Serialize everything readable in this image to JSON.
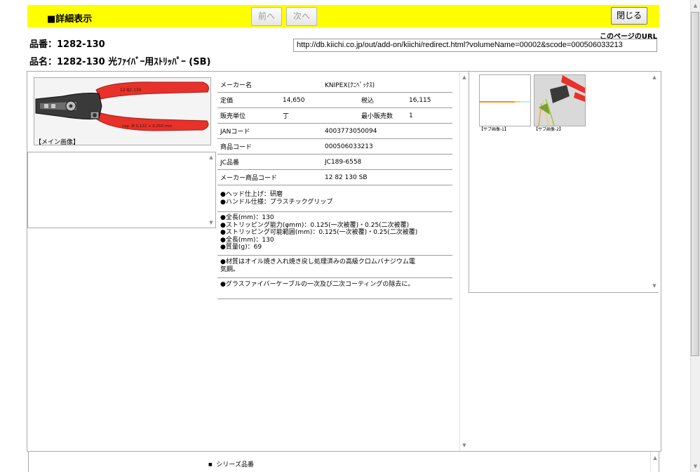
{
  "header": {
    "title": "■詳細表示",
    "prev_label": "前へ",
    "next_label": "次へ",
    "close_label": "閉じる"
  },
  "product": {
    "number_line": "品番：1282-130",
    "name_line": "品名：1282-130 光ﾌｧｲﾊﾞｰ用ｽﾄﾘｯﾊﾟｰ (SB)"
  },
  "page_url": {
    "label": "このページのURL",
    "value": "http://db.kiichi.co.jp/out/add-on/kiichi/redirect.html?volumeName=00002&scode=000506033213"
  },
  "main_image": {
    "caption": "【メイン画像】",
    "print_model": "12 82 130",
    "print_spec": "cap. Ø 0,122 + 0,250 mm"
  },
  "specs": {
    "maker_label": "メーカー名",
    "maker_value": "KNIPEX(ｸﾆﾍﾟｯｸｽ)",
    "price_label": "定価",
    "price_value": "14,650",
    "tax_label": "税込",
    "tax_value": "16,115",
    "unit_label": "販売単位",
    "unit_value": "丁",
    "min_label": "最小販売数",
    "min_value": "1",
    "jan_label": "JANコード",
    "jan_value": "4003773050094",
    "code_label": "商品コード",
    "code_value": "000506033213",
    "jc_label": "JC品番",
    "jc_value": "JC189-6558",
    "maker_code_label": "メーカー商品コード",
    "maker_code_value": "12 82 130 SB"
  },
  "notes": [
    [
      "●ヘッド仕上げ：研磨",
      "●ハンドル仕様：プラスチックグリップ"
    ],
    [
      "●全長(mm)：130",
      "●ストリッピング能力(φmm)：0.125(一次被覆)・0.25(二次被覆)",
      "●ストリッピング可能範囲(mm)：0.125(一次被覆)・0.25(二次被覆)",
      "●全長(mm)：130",
      "●質量(g)：69"
    ],
    [
      "●材質はオイル焼き入れ焼き戻し処理済みの高級クロムバナジウム電",
      "気鋼。"
    ],
    [
      "●グラスファイバーケーブルの一次及び二次コーティングの除去に。"
    ]
  ],
  "sub_images": [
    {
      "caption": "【サブ画像-1】"
    },
    {
      "caption": "【サブ画像-2】"
    }
  ],
  "series": {
    "label": "シリーズ品番"
  },
  "scroll_icons": {
    "up": "▲",
    "down": "▼"
  },
  "colors": {
    "header_bg": "#ffff00",
    "handle_red": "#e8312a",
    "fiber_orange": "#ff8c1a"
  }
}
